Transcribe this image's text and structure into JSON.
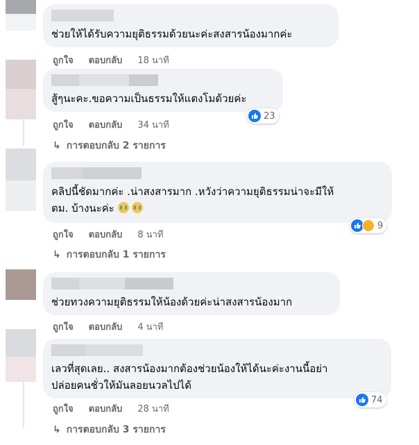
{
  "comments": [
    {
      "text": "ช่วยให้ได้รับความยุติธรรมด้วยนะค่ะสงสารน้องมากค่ะ",
      "like_label": "ถูกใจ",
      "reply_label": "ตอบกลับ",
      "time": "18 นาที"
    },
    {
      "text": "สู้ๆนะคะ.ขอความเป็นธรรมให้แตงโมด้วยค่ะ",
      "like_label": "ถูกใจ",
      "reply_label": "ตอบกลับ",
      "time": "34 นาที",
      "reaction_count": "23",
      "replies_link": "การตอบกลับ 2 รายการ"
    },
    {
      "text_line1": "คลิปนี้ชัดมากค่ะ .น่าสงสารมาก .หวังว่าความยุติธรรมน่าจะมีให้",
      "text_line2": "ตม. บ้างนะค่ะ",
      "like_label": "ถูกใจ",
      "reply_label": "ตอบกลับ",
      "time": "8 นาที",
      "reaction_count": "9",
      "replies_link": "การตอบกลับ 1 รายการ"
    },
    {
      "text": "ช่วยทวงความยุติธรรมให้น้องด้วยค่ะน่าสงสารน้องมาก",
      "like_label": "ถูกใจ",
      "reply_label": "ตอบกลับ",
      "time": "4 นาที"
    },
    {
      "text_line1": "เลวที่สุดเลย.. สงสารน้องมากต้องช่วยน้องให้ได้นะค่ะงานนี้อย่า",
      "text_line2": "ปล่อยคนชั่วให้มันลอยนวลไปได้",
      "like_label": "ถูกใจ",
      "reply_label": "ตอบกลับ",
      "time": "28 นาที",
      "reaction_count": "74",
      "replies_link": "การตอบกลับ 3 รายการ"
    }
  ],
  "colors": {
    "bubble": "#f0f2f5",
    "secondary_text": "#65676b",
    "like_blue": "#1877f2",
    "sad_yellow": "#f7b125"
  },
  "icons": [
    "like-reaction-icon",
    "sad-reaction-icon",
    "reply-arrow-icon",
    "crying-face-emoji"
  ]
}
